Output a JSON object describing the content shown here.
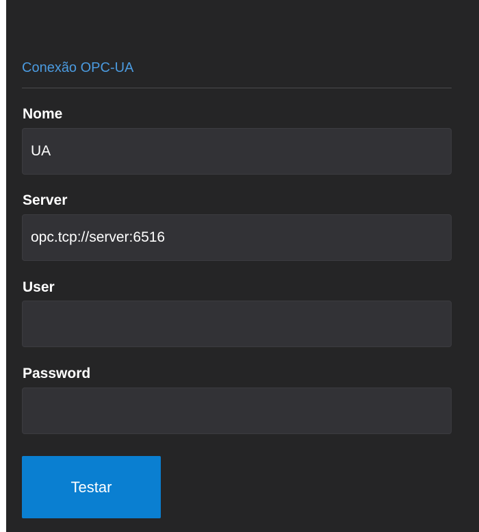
{
  "section": {
    "title": "Conexão OPC-UA"
  },
  "fields": {
    "name": {
      "label": "Nome",
      "value": "UA",
      "placeholder": ""
    },
    "server": {
      "label": "Server",
      "value": "opc.tcp://server:6516",
      "placeholder": ""
    },
    "user": {
      "label": "User",
      "value": "",
      "placeholder": ""
    },
    "password": {
      "label": "Password",
      "value": "",
      "placeholder": ""
    }
  },
  "actions": {
    "test_label": "Testar"
  },
  "colors": {
    "panel_background": "#252526",
    "title_accent": "#4b9be0",
    "input_background": "#323236",
    "button_primary": "#0a7fd1"
  }
}
